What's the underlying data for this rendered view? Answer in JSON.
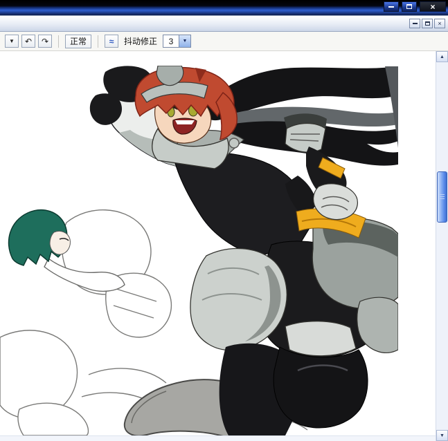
{
  "window": {
    "title": ""
  },
  "toolbar": {
    "normal_label": "正常",
    "stabilizer_label": "抖动修正",
    "stabilizer_value": "3"
  },
  "icons": {
    "close": "×",
    "child_close": "×",
    "dropdown": "▼",
    "undo": "↶",
    "redo": "↷",
    "stabilizer": "≈",
    "combo_arrow": "▼",
    "scroll_up": "▲",
    "scroll_down": "▼"
  },
  "palette": {
    "titlebar_blue": "#2f5fd0",
    "scroll_thumb_blue": "#5a8bea",
    "canvas_bg": "#ffffff",
    "hair_red": "#c04a30",
    "eye_yellow_green": "#a8aa32",
    "armor_gray": "#a9b0ac",
    "suit_black": "#1b1b1d",
    "accent_yellow": "#efac1e",
    "teal_hair": "#1e6e5c",
    "sketch_line_gray": "#777777"
  }
}
